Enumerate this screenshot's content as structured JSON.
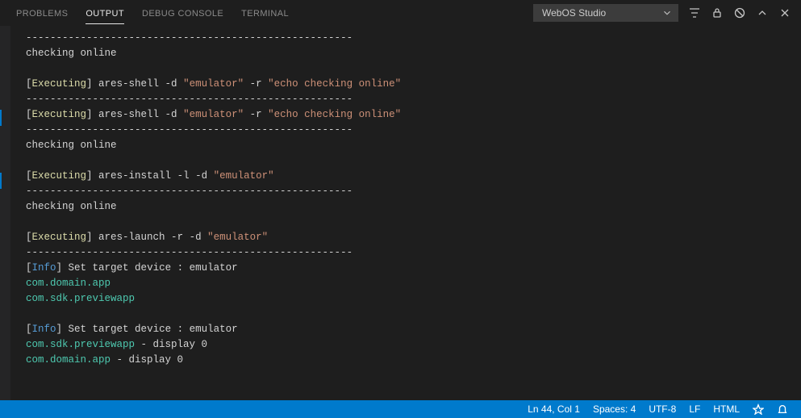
{
  "tabs": {
    "problems": "PROBLEMS",
    "output": "OUTPUT",
    "debug_console": "DEBUG CONSOLE",
    "terminal": "TERMINAL"
  },
  "channel": {
    "selected": "WebOS Studio"
  },
  "actions": {
    "filter": "filter-icon",
    "lock": "lock-icon",
    "clear": "clear-icon",
    "chevup": "chevron-up-icon",
    "close": "close-icon"
  },
  "output_lines": [
    {
      "kind": "dash"
    },
    {
      "kind": "plain",
      "text": "checking online"
    },
    {
      "kind": "blank"
    },
    {
      "kind": "exec",
      "cmd": "ares-shell -d ",
      "args": [
        {
          "t": "str",
          "v": "\"emulator\""
        },
        {
          "t": "plain",
          "v": " -r "
        },
        {
          "t": "str",
          "v": "\"echo checking online\""
        }
      ]
    },
    {
      "kind": "dash"
    },
    {
      "kind": "exec",
      "cmd": "ares-shell -d ",
      "args": [
        {
          "t": "str",
          "v": "\"emulator\""
        },
        {
          "t": "plain",
          "v": " -r "
        },
        {
          "t": "str",
          "v": "\"echo checking online\""
        }
      ]
    },
    {
      "kind": "dash"
    },
    {
      "kind": "plain",
      "text": "checking online"
    },
    {
      "kind": "blank"
    },
    {
      "kind": "exec",
      "cmd": "ares-install -l -d ",
      "args": [
        {
          "t": "str",
          "v": "\"emulator\""
        }
      ]
    },
    {
      "kind": "dash"
    },
    {
      "kind": "plain",
      "text": "checking online"
    },
    {
      "kind": "blank"
    },
    {
      "kind": "exec",
      "cmd": "ares-launch -r -d ",
      "args": [
        {
          "t": "str",
          "v": "\"emulator\""
        }
      ]
    },
    {
      "kind": "dash"
    },
    {
      "kind": "info",
      "text": "Set target device : emulator"
    },
    {
      "kind": "teal",
      "text": "com.domain.app"
    },
    {
      "kind": "teal",
      "text": "com.sdk.previewapp"
    },
    {
      "kind": "blank"
    },
    {
      "kind": "info",
      "text": "Set target device : emulator"
    },
    {
      "kind": "teal_suffix",
      "teal": "com.sdk.previewapp",
      "suffix": " - display 0"
    },
    {
      "kind": "teal_suffix",
      "teal": "com.domain.app",
      "suffix": " - display 0"
    }
  ],
  "tokens": {
    "executing": "Executing",
    "info": "Info",
    "dash_line": "------------------------------------------------------"
  },
  "statusbar": {
    "ln_col": "Ln 44, Col 1",
    "spaces": "Spaces: 4",
    "encoding": "UTF-8",
    "eol": "LF",
    "lang": "HTML"
  }
}
